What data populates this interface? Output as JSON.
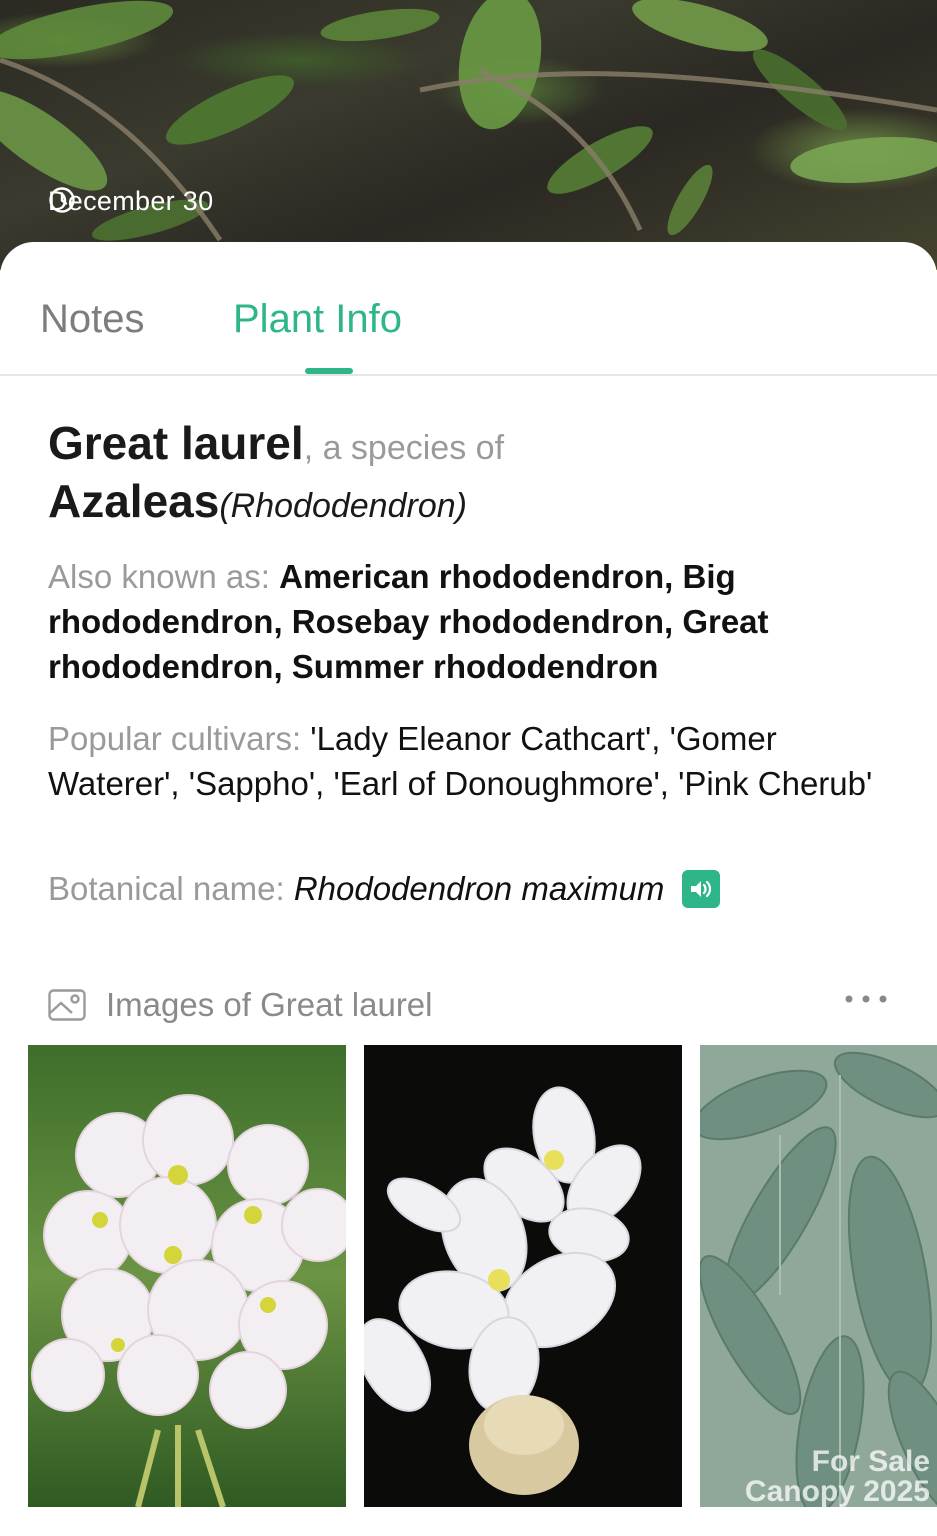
{
  "hero": {
    "date": "December 30"
  },
  "tabs": [
    {
      "label": "Notes",
      "active": false
    },
    {
      "label": "Plant Info",
      "active": true
    }
  ],
  "plant": {
    "common_name": "Great laurel",
    "species_of": ", a species of",
    "genus": "Azaleas",
    "genus_latin": "(Rhododendron)",
    "aka_label": "Also known as: ",
    "aka_value": "American rhododendron, Big rhododendron, Rosebay rhododendron, Great rhododendron, Summer rhododendron",
    "cultivars_label": "Popular cultivars: ",
    "cultivars_value": "'Lady Eleanor Cathcart', 'Gomer Waterer', 'Sappho', 'Earl of Donoughmore', 'Pink Cherub'",
    "botanical_label": "Botanical name: ",
    "botanical_value": "Rhododendron maximum"
  },
  "images": {
    "title": "Images of Great laurel",
    "watermark_line1": "For Sale",
    "watermark_line2": "Canopy 2025"
  },
  "colors": {
    "accent": "#2fb58a",
    "label_gray": "#9a9a9a",
    "text_dark": "#111111"
  },
  "icons": [
    "clock-icon",
    "speaker-icon",
    "gallery-icon",
    "more-icon"
  ]
}
